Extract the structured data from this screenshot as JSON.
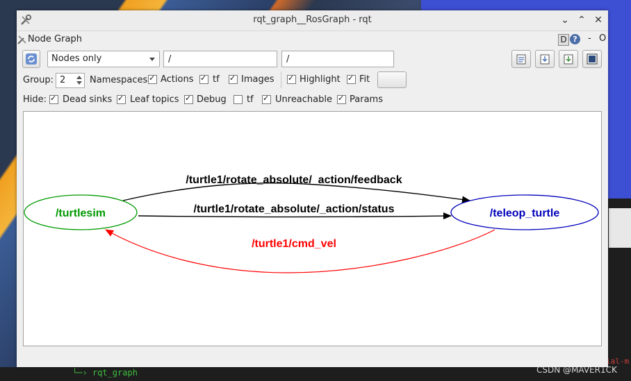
{
  "window": {
    "title": "rqt_graph__RosGraph - rqt",
    "plugin_title": "Node Graph",
    "plugin_buttons": {
      "d": "D",
      "help": "?",
      "dash": "-",
      "o": "O"
    }
  },
  "toolbar": {
    "mode": "Nodes only",
    "node_filter": "/",
    "topic_filter": "/"
  },
  "options": {
    "group_label": "Group:",
    "group_value": "2",
    "items": [
      {
        "label": "Namespaces",
        "checked": true
      },
      {
        "label": "Actions",
        "checked": true
      },
      {
        "label": "tf",
        "checked": true
      },
      {
        "label": "Images",
        "checked": true
      },
      {
        "label": "Highlight",
        "checked": true
      },
      {
        "label": "Fit",
        "checked": true
      }
    ]
  },
  "hide": {
    "label": "Hide:",
    "items": [
      {
        "label": "Dead sinks",
        "checked": true
      },
      {
        "label": "Leaf topics",
        "checked": true
      },
      {
        "label": "Debug",
        "checked": true
      },
      {
        "label": "tf",
        "checked": false
      },
      {
        "label": "Unreachable",
        "checked": true
      },
      {
        "label": "Params",
        "checked": true
      }
    ]
  },
  "graph": {
    "nodes": [
      {
        "id": "turtlesim",
        "label": "/turtlesim",
        "color": "#009900"
      },
      {
        "id": "teleop",
        "label": "/teleop_turtle",
        "color": "#0000bb"
      }
    ],
    "edges": [
      {
        "label": "/turtle1/rotate_absolute/_action/feedback",
        "color": "#000000"
      },
      {
        "label": "/turtle1/rotate_absolute/_action/status",
        "color": "#000000"
      },
      {
        "label": "/turtle1/cmd_vel",
        "color": "#ff0000"
      }
    ]
  },
  "desktop": {
    "terminal_prompt": "└─› rqt_graph",
    "terminal_snippet": "ial-m",
    "watermark": "CSDN @MAVER1CK"
  }
}
